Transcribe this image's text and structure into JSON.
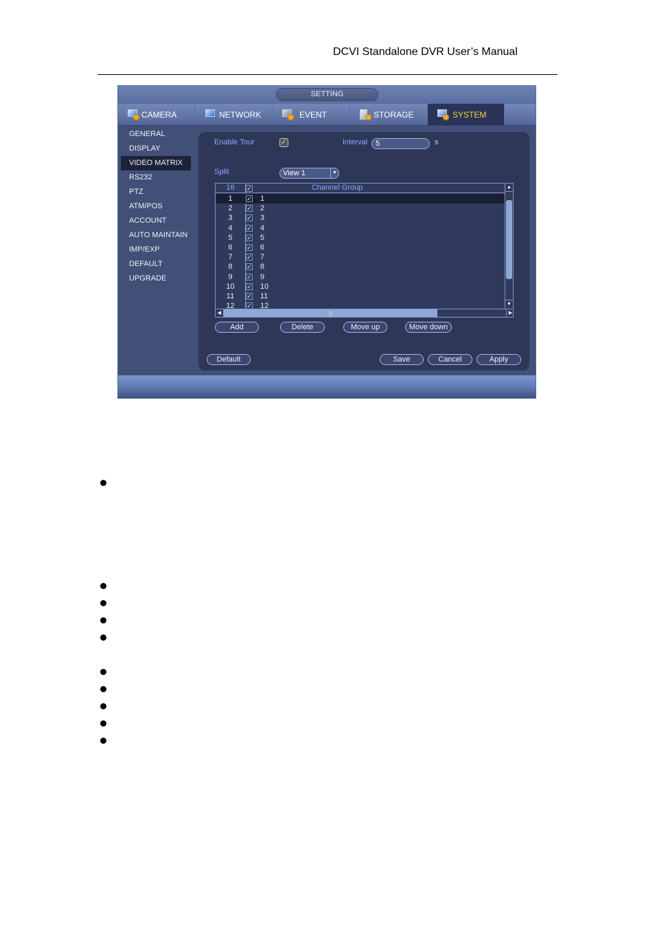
{
  "document": {
    "header_title": "DCVI Standalone DVR User’s Manual",
    "bullet_count": 10
  },
  "window": {
    "title": "SETTING"
  },
  "tabs": [
    {
      "label": "CAMERA",
      "icon": "camera-settings-icon",
      "active": false
    },
    {
      "label": "NETWORK",
      "icon": "network-icon",
      "active": false
    },
    {
      "label": "EVENT",
      "icon": "event-icon",
      "active": false
    },
    {
      "label": "STORAGE",
      "icon": "storage-icon",
      "active": false
    },
    {
      "label": "SYSTEM",
      "icon": "system-icon",
      "active": true
    }
  ],
  "sidebar": {
    "items": [
      {
        "label": "GENERAL"
      },
      {
        "label": "DISPLAY"
      },
      {
        "label": "VIDEO MATRIX",
        "active": true
      },
      {
        "label": "RS232"
      },
      {
        "label": "PTZ"
      },
      {
        "label": "ATM/POS"
      },
      {
        "label": "ACCOUNT"
      },
      {
        "label": "AUTO MAINTAIN"
      },
      {
        "label": "IMP/EXP"
      },
      {
        "label": "DEFAULT"
      },
      {
        "label": "UPGRADE"
      }
    ]
  },
  "form": {
    "enable_tour_label": "Enable Tour",
    "enable_tour_checked": true,
    "interval_label": "Interval",
    "interval_value": "5",
    "interval_unit": "s",
    "split_label": "Split",
    "split_value": "View 1"
  },
  "channel_table": {
    "header_count": "16",
    "header_title": "Channel Group",
    "rows": [
      {
        "num": "1",
        "checked": true,
        "group": "1",
        "selected": true
      },
      {
        "num": "2",
        "checked": true,
        "group": "2"
      },
      {
        "num": "3",
        "checked": true,
        "group": "3"
      },
      {
        "num": "4",
        "checked": true,
        "group": "4"
      },
      {
        "num": "5",
        "checked": true,
        "group": "5"
      },
      {
        "num": "6",
        "checked": true,
        "group": "6"
      },
      {
        "num": "7",
        "checked": true,
        "group": "7"
      },
      {
        "num": "8",
        "checked": true,
        "group": "8"
      },
      {
        "num": "9",
        "checked": true,
        "group": "9"
      },
      {
        "num": "10",
        "checked": true,
        "group": "10"
      },
      {
        "num": "11",
        "checked": true,
        "group": "11"
      },
      {
        "num": "12",
        "checked": true,
        "group": "12"
      }
    ]
  },
  "buttons": {
    "add": "Add",
    "delete": "Delete",
    "move_up": "Move up",
    "move_down": "Move down",
    "default": "Default",
    "save": "Save",
    "cancel": "Cancel",
    "apply": "Apply"
  },
  "colors": {
    "active_tab_text": "#f0d23a",
    "label_blue": "#8fa8ff",
    "panel_bg": "#2e3757"
  }
}
